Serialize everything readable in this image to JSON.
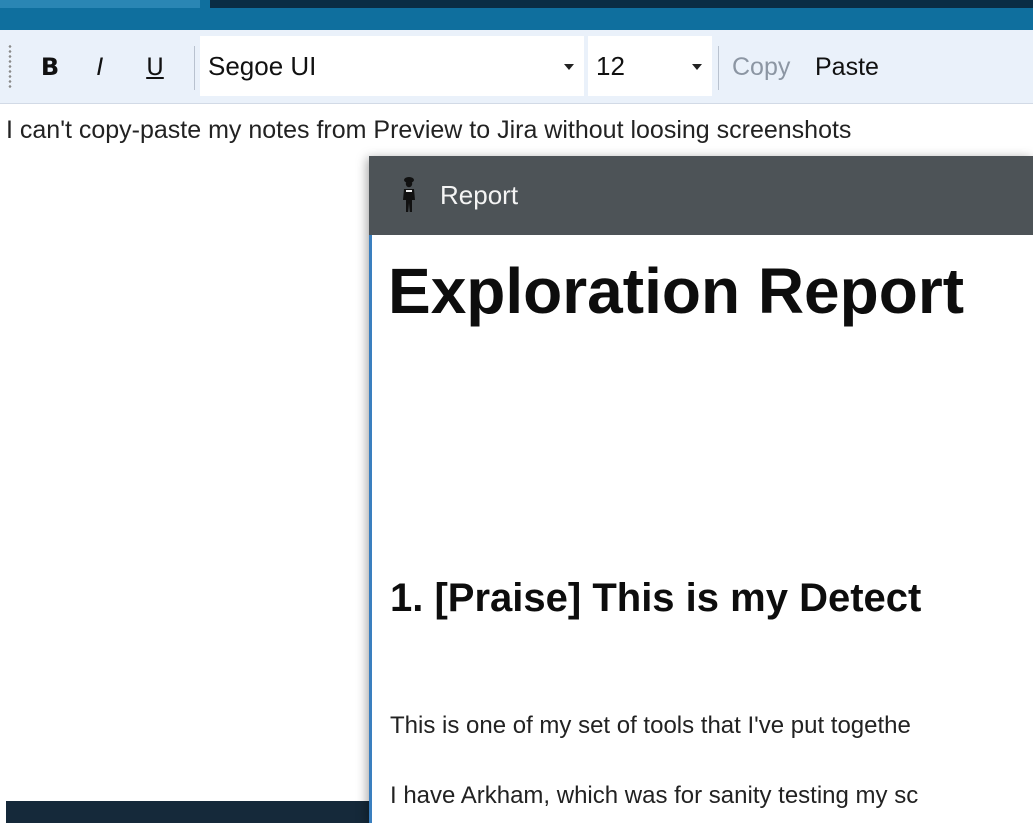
{
  "toolbar": {
    "bold_label": "B",
    "italic_label": "I",
    "underline_label": "U",
    "font_family_value": "Segoe UI",
    "font_size_value": "12",
    "copy_label": "Copy",
    "paste_label": "Paste"
  },
  "editor": {
    "text": "I can't copy-paste my notes from Preview to Jira without loosing screenshots"
  },
  "report_window": {
    "title": "Report",
    "heading": "Exploration Report",
    "section_heading": "1. [Praise] This is my Detect",
    "paragraphs": [
      "This is one of my set of tools that I've put togethe",
      "I have Arkham, which was for sanity testing my sc"
    ]
  },
  "colors": {
    "app_strip": "#0f6f9e",
    "toolbar_bg": "#eaf1fa",
    "titlebar_bg": "#4d5357",
    "window_border": "#3a7fbf",
    "copy_disabled": "#8c96a3"
  },
  "icons": {
    "report_window_icon": "detective-figure-icon",
    "combo_caret": "caret-down-icon"
  }
}
